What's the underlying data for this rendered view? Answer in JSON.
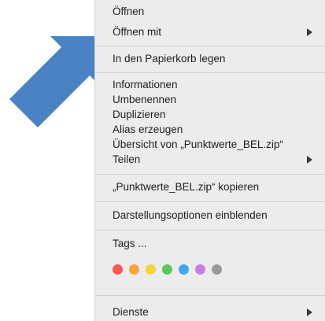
{
  "menu": {
    "groups": [
      [
        "Öffnen",
        "Öffnen mit"
      ],
      [
        "In den Papierkorb legen"
      ],
      [
        "Informationen",
        "Umbenennen",
        "Duplizieren",
        "Alias erzeugen",
        "Übersicht von „Punktwerte_BEL.zip“",
        "Teilen"
      ],
      [
        "„Punktwerte_BEL.zip“ kopieren"
      ],
      [
        "Darstellungsoptionen einblenden"
      ],
      [
        "Tags ..."
      ],
      [
        "Dienste"
      ]
    ]
  },
  "tags": {
    "colors": [
      "#f25a52",
      "#f5a53a",
      "#f5d43a",
      "#58c95a",
      "#3fa6f0",
      "#c57fe0",
      "#9a9a9a"
    ]
  },
  "annotation": {
    "arrow_color": "#4a82c4"
  }
}
